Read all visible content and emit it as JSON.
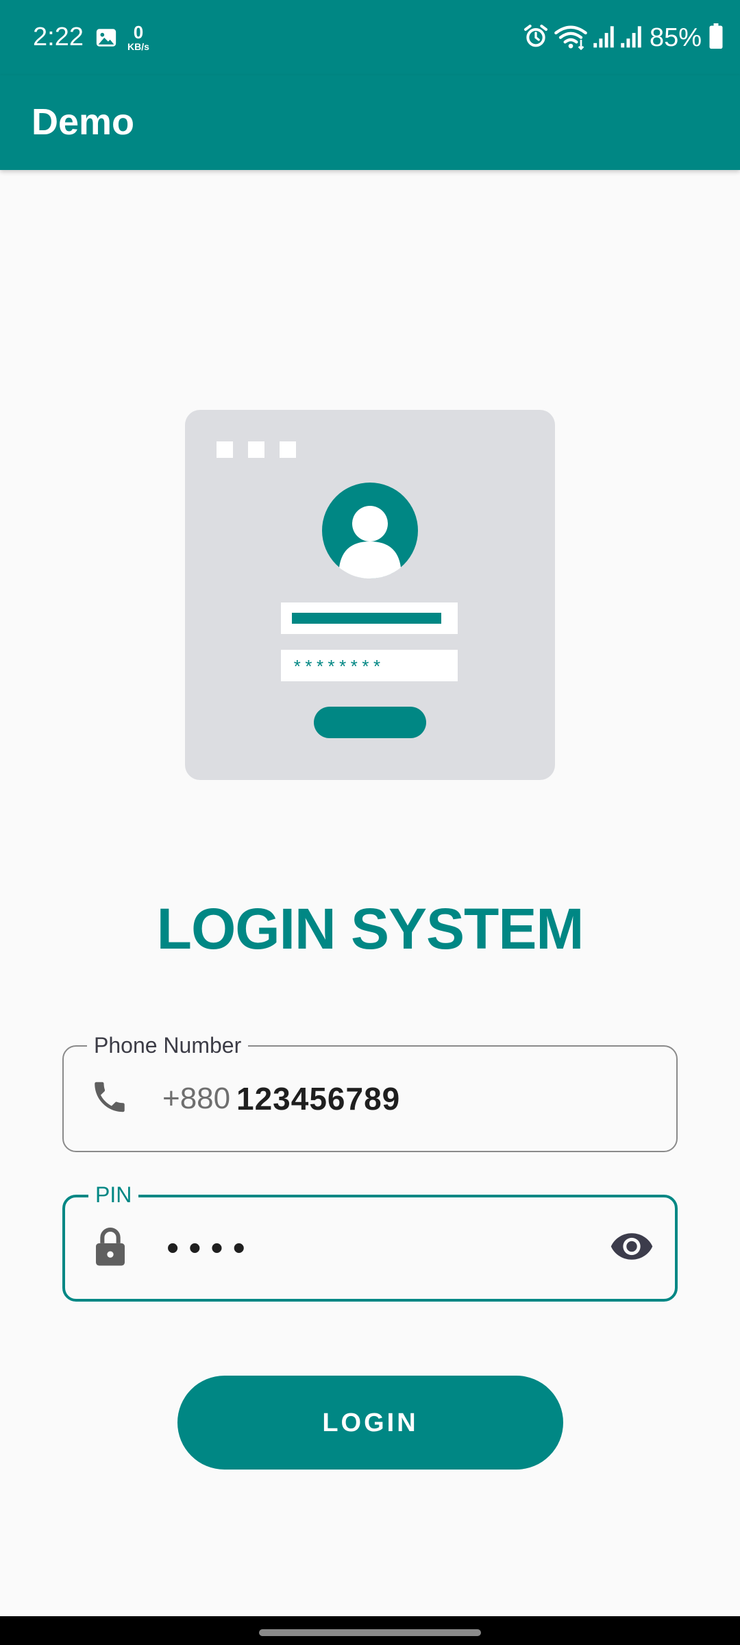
{
  "status_bar": {
    "time": "2:22",
    "net_speed_value": "0",
    "net_speed_unit": "KB/s",
    "battery_percent": "85%",
    "icons": [
      "gallery-icon",
      "alarm-icon",
      "wifi-icon",
      "signal-icon",
      "signal-icon",
      "battery-icon"
    ]
  },
  "app_bar": {
    "title": "Demo"
  },
  "illustration": {
    "password_mask": "********"
  },
  "heading": "LOGIN SYSTEM",
  "phone_field": {
    "label": "Phone Number",
    "prefix": "+880",
    "value": "123456789",
    "icon": "phone-icon"
  },
  "pin_field": {
    "label": "PIN",
    "value_masked": "••••",
    "icon": "lock-icon",
    "toggle_icon": "eye-icon",
    "state": "focused"
  },
  "login_button": {
    "label": "LOGIN"
  },
  "colors": {
    "primary": "#008784",
    "background": "#fafafa",
    "illustration_bg": "#dcdde1",
    "outline": "#8a8a8a",
    "text_dark": "#1f1f1f"
  }
}
